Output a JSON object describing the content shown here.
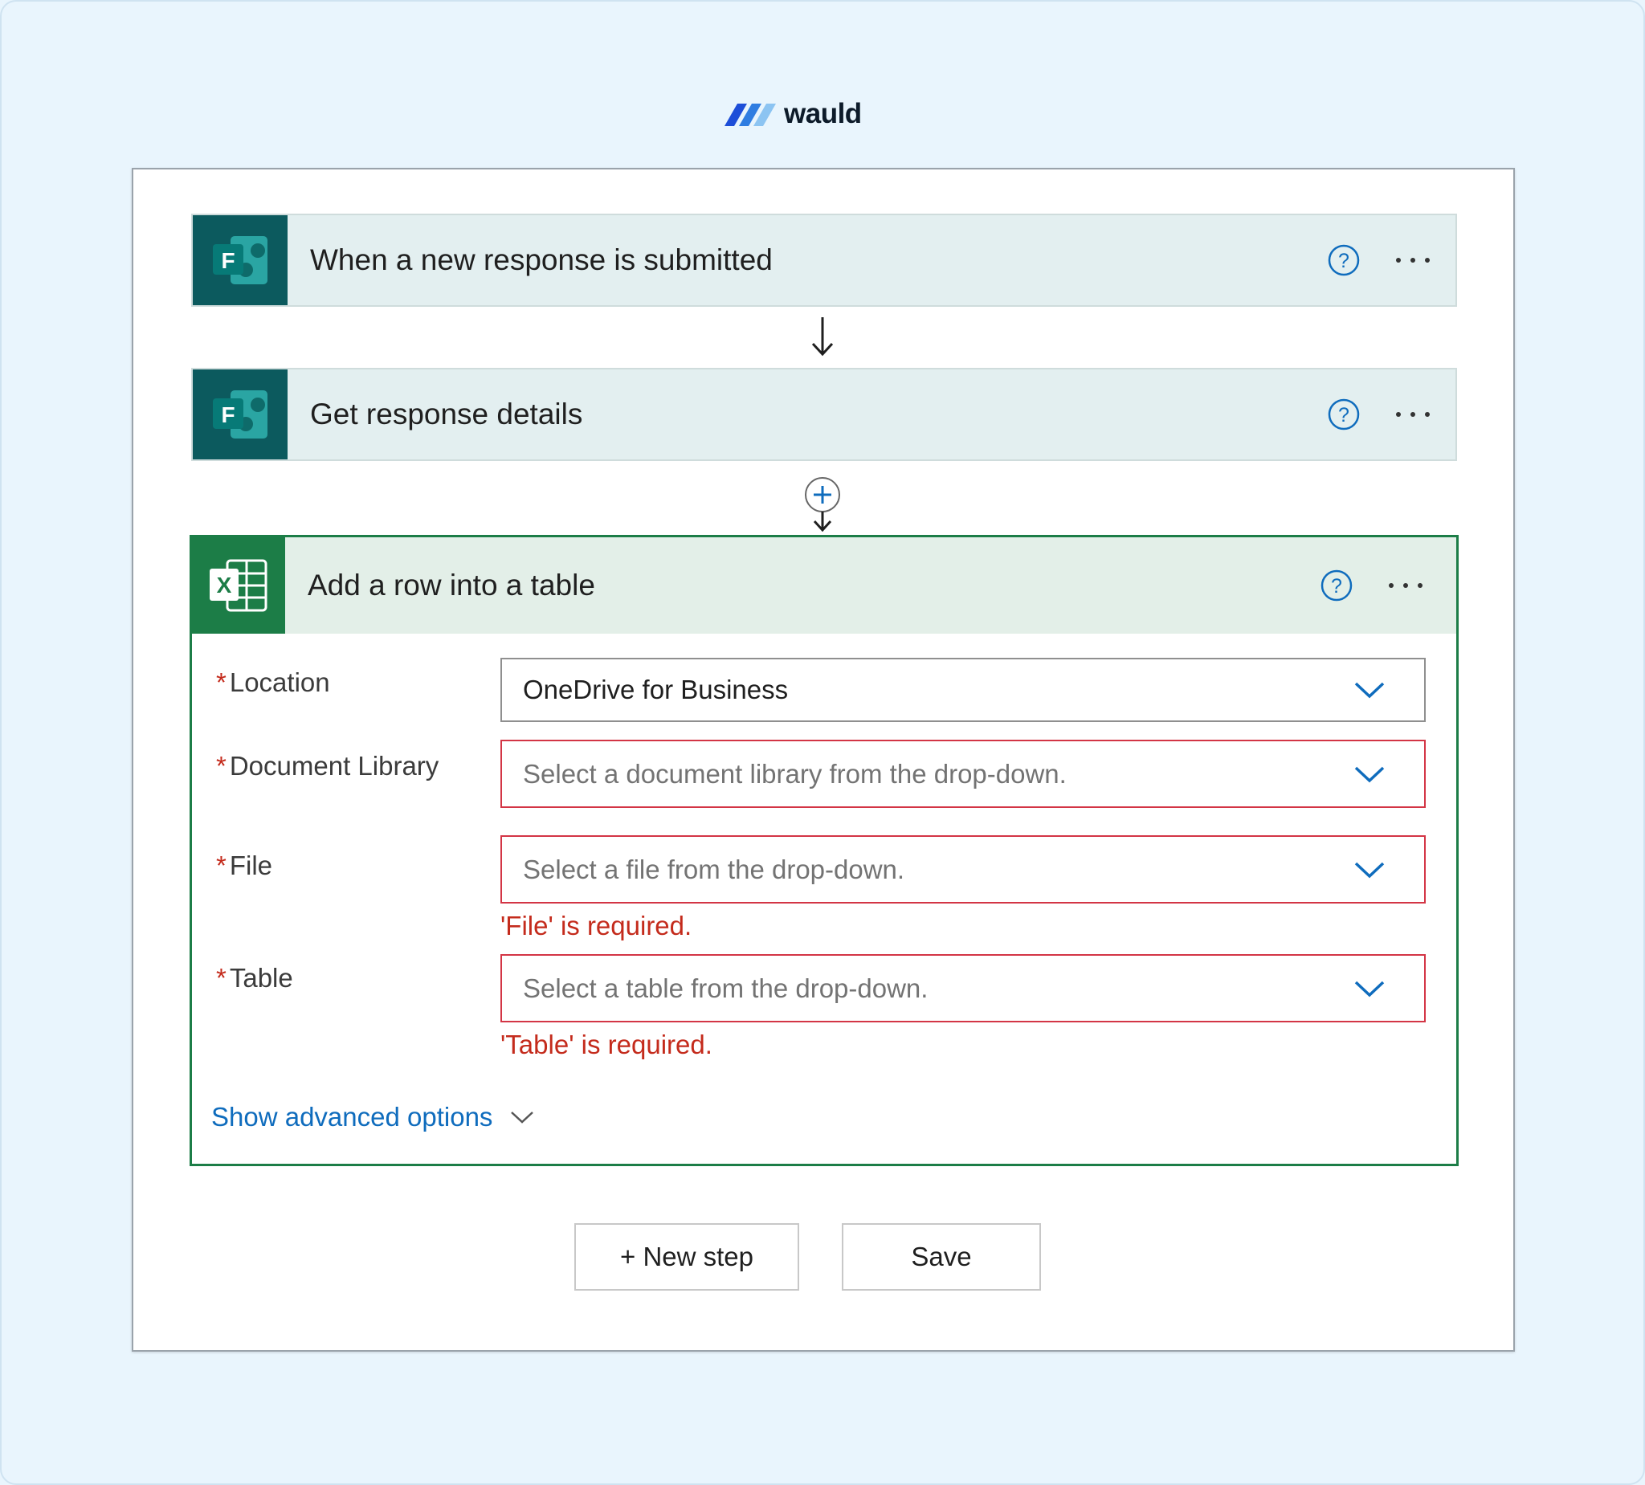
{
  "brand": {
    "name": "wauld"
  },
  "steps": [
    {
      "title": "When a new response is submitted",
      "icon": "microsoft-forms-icon"
    },
    {
      "title": "Get response details",
      "icon": "microsoft-forms-icon"
    }
  ],
  "action": {
    "title": "Add a row into a table",
    "icon": "excel-icon",
    "fields": {
      "location": {
        "label": "Location",
        "value": "OneDrive for Business"
      },
      "document_library": {
        "label": "Document Library",
        "placeholder": "Select a document library from the drop-down."
      },
      "file": {
        "label": "File",
        "placeholder": "Select a file from the drop-down.",
        "error": "'File' is required."
      },
      "table": {
        "label": "Table",
        "placeholder": "Select a table from the drop-down.",
        "error": "'Table' is required."
      }
    },
    "advanced_label": "Show advanced options"
  },
  "buttons": {
    "new_step": "+ New step",
    "save": "Save"
  },
  "colors": {
    "forms_green": "#0c5a5e",
    "excel_green": "#1c7d47",
    "link_blue": "#0f6cbd",
    "error_red": "#c42b1c",
    "background": "#e9f5fd"
  }
}
